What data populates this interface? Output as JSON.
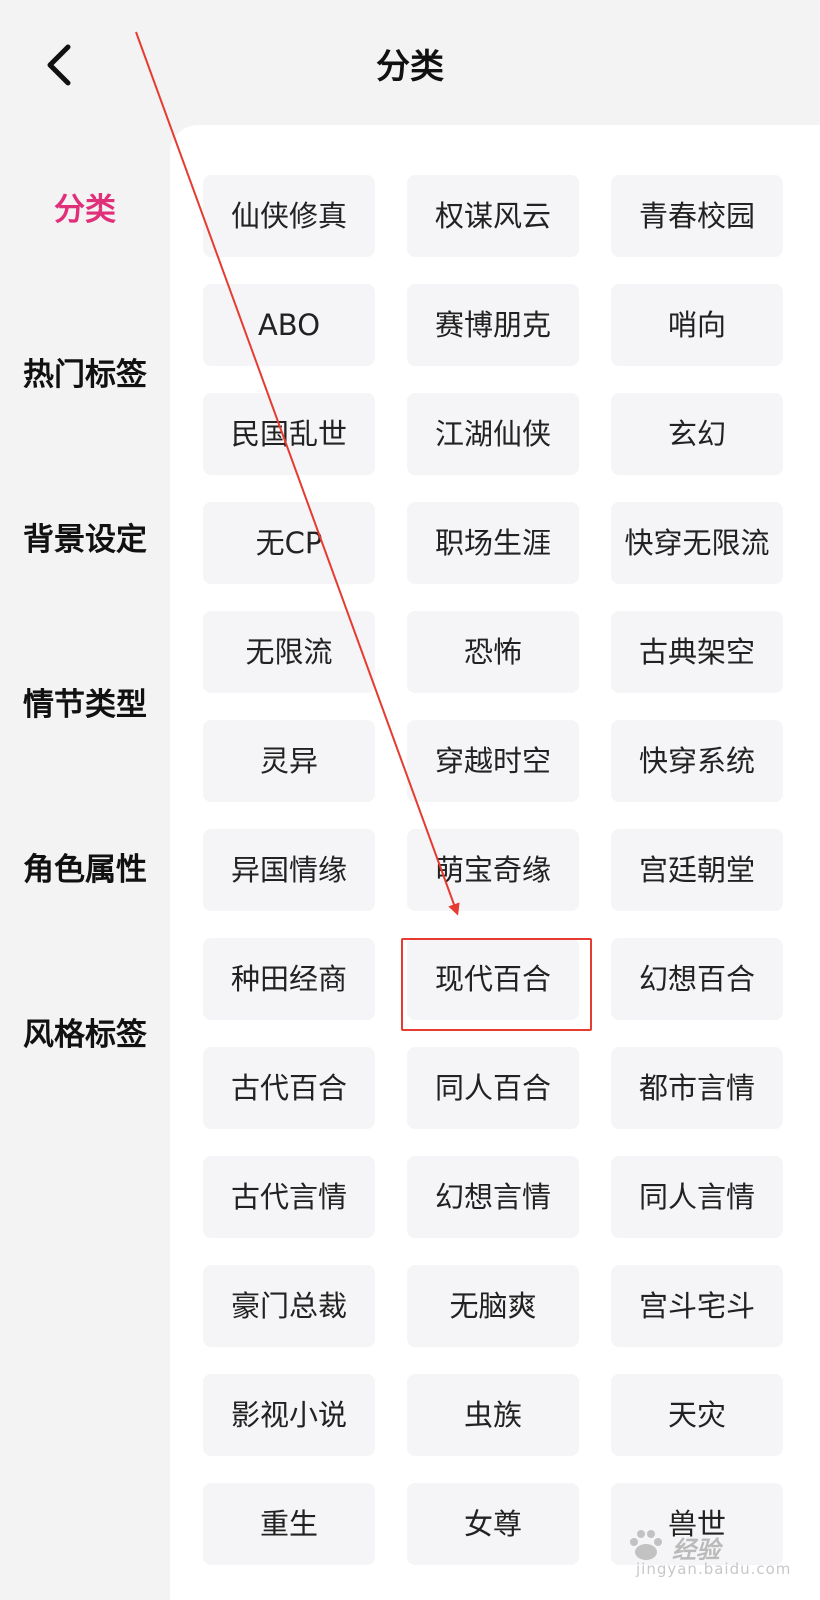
{
  "header": {
    "title": "分类",
    "back_icon": "chevron-left-icon"
  },
  "sidebar": {
    "active_color": "#e0307a",
    "items": [
      {
        "label": "分类",
        "active": true
      },
      {
        "label": "热门标签",
        "active": false
      },
      {
        "label": "背景设定",
        "active": false
      },
      {
        "label": "情节类型",
        "active": false
      },
      {
        "label": "角色属性",
        "active": false
      },
      {
        "label": "风格标签",
        "active": false
      }
    ]
  },
  "tags": [
    "仙侠修真",
    "权谋风云",
    "青春校园",
    "ABO",
    "赛博朋克",
    "哨向",
    "民国乱世",
    "江湖仙侠",
    "玄幻",
    "无CP",
    "职场生涯",
    "快穿无限流",
    "无限流",
    "恐怖",
    "古典架空",
    "灵异",
    "穿越时空",
    "快穿系统",
    "异国情缘",
    "萌宝奇缘",
    "宫廷朝堂",
    "种田经商",
    "现代百合",
    "幻想百合",
    "古代百合",
    "同人百合",
    "都市言情",
    "古代言情",
    "幻想言情",
    "同人言情",
    "豪门总裁",
    "无脑爽",
    "宫斗宅斗",
    "影视小说",
    "虫族",
    "天灾",
    "重生",
    "女尊",
    "兽世"
  ],
  "annotation": {
    "highlighted_tag": "现代百合",
    "color": "#e53b30",
    "icon": "arrow-annotation-icon"
  },
  "watermark": {
    "brand": "经验",
    "url": "jingyan.baidu.com",
    "icon": "baidu-paw-icon"
  }
}
